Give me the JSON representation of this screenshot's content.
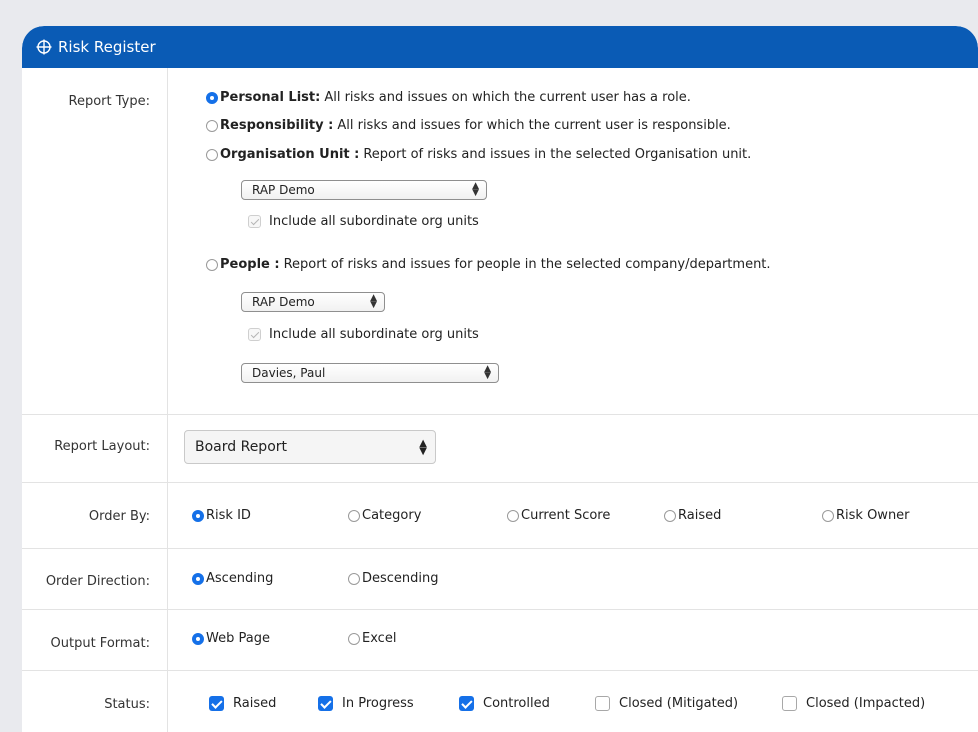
{
  "header": {
    "title": "Risk Register",
    "icon": "crosshair-icon"
  },
  "report_type": {
    "label": "Report Type:",
    "options": [
      {
        "name": "Personal List:",
        "desc": "All risks and issues on which the current user has a role.",
        "selected": true
      },
      {
        "name": "Responsibility :",
        "desc": "All risks and issues for which the current user is responsible.",
        "selected": false
      },
      {
        "name": "Organisation Unit :",
        "desc": "Report of risks and issues in the selected Organisation unit.",
        "selected": false
      },
      {
        "name": "People :",
        "desc": "Report of risks and issues for people in the selected company/department.",
        "selected": false
      }
    ],
    "org_unit_select": "RAP Demo",
    "org_unit_subordinate": "Include all subordinate org units",
    "people_org_select": "RAP Demo",
    "people_subordinate": "Include all subordinate org units",
    "person_select": "Davies, Paul"
  },
  "report_layout": {
    "label": "Report Layout:",
    "value": "Board Report"
  },
  "order_by": {
    "label": "Order By:",
    "options": [
      "Risk ID",
      "Category",
      "Current Score",
      "Raised",
      "Risk Owner"
    ],
    "selected": "Risk ID"
  },
  "order_direction": {
    "label": "Order Direction:",
    "options": [
      "Ascending",
      "Descending"
    ],
    "selected": "Ascending"
  },
  "output_format": {
    "label": "Output Format:",
    "options": [
      "Web Page",
      "Excel"
    ],
    "selected": "Web Page"
  },
  "status": {
    "label": "Status:",
    "options": [
      {
        "label": "Raised",
        "checked": true
      },
      {
        "label": "In Progress",
        "checked": true
      },
      {
        "label": "Controlled",
        "checked": true
      },
      {
        "label": "Closed (Mitigated)",
        "checked": false
      },
      {
        "label": "Closed (Impacted)",
        "checked": false
      }
    ]
  },
  "colors": {
    "header": "#0a5bb5",
    "accent": "#1570e8"
  }
}
